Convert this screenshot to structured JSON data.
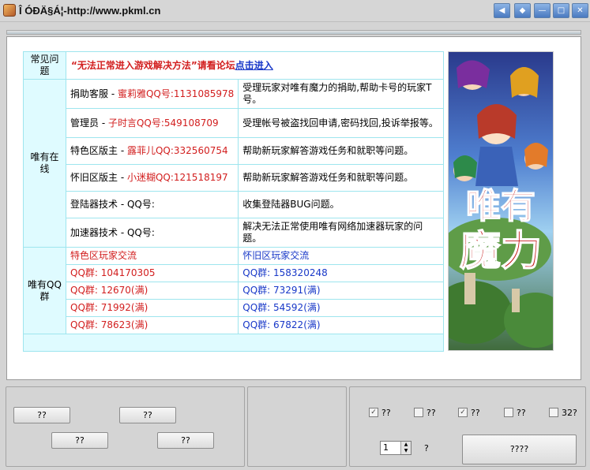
{
  "window": {
    "title": "Î ÓÐÄ§Á¦-http://www.pkml.cn",
    "controls": [
      "◀",
      "◆",
      "—",
      "□",
      "✕"
    ]
  },
  "notice": {
    "label": "常见问题",
    "text": "“无法正常进入游戏解决方法”请看论坛",
    "link": "点击进入"
  },
  "online": {
    "label": "唯有在线",
    "rows": [
      {
        "role": "捐助客服 - ",
        "contact": "蜜莉雅QQ号:1131085978",
        "desc": "受理玩家对唯有魔力的捐助,帮助卡号的玩家T号。"
      },
      {
        "role": "管理员 - ",
        "contact": "子时言QQ号:549108709",
        "desc": "受理帐号被盗找回申请,密码找回,投诉举报等。"
      },
      {
        "role": "特色区版主 - ",
        "contact": "露菲儿QQ:332560754",
        "desc": "帮助新玩家解答游戏任务和就职等问题。"
      },
      {
        "role": "怀旧区版主 - ",
        "contact": "小迷糊QQ:121518197",
        "desc": "帮助新玩家解答游戏任务和就职等问题。"
      },
      {
        "role": "登陆器技术 - QQ号:",
        "contact": "",
        "desc": "收集登陆器BUG问题。"
      },
      {
        "role": "加速器技术 - QQ号:",
        "contact": "",
        "desc": "解决无法正常使用唯有网络加速器玩家的问题。"
      }
    ]
  },
  "groups": {
    "label": "唯有QQ群",
    "left_title": "特色区玩家交流",
    "right_title": "怀旧区玩家交流",
    "left": [
      "QQ群: 104170305",
      "QQ群: 12670(满)",
      "QQ群: 71992(满)",
      "QQ群: 78623(满)"
    ],
    "right": [
      "QQ群: 158320248",
      "QQ群: 73291(满)",
      "QQ群: 54592(满)",
      "QQ群: 67822(满)"
    ]
  },
  "poster": {
    "text_top": "唯有",
    "text_bottom": "魔力"
  },
  "bottom": {
    "left_buttons": [
      "??",
      "??",
      "??",
      "??"
    ],
    "checks": [
      {
        "label": "??",
        "checked": true
      },
      {
        "label": "??",
        "checked": false
      },
      {
        "label": "??",
        "checked": true
      },
      {
        "label": "??",
        "checked": false
      },
      {
        "label": "32?",
        "checked": false
      }
    ],
    "spinner_value": "1",
    "spinner_label": "?",
    "start_button": "????"
  }
}
